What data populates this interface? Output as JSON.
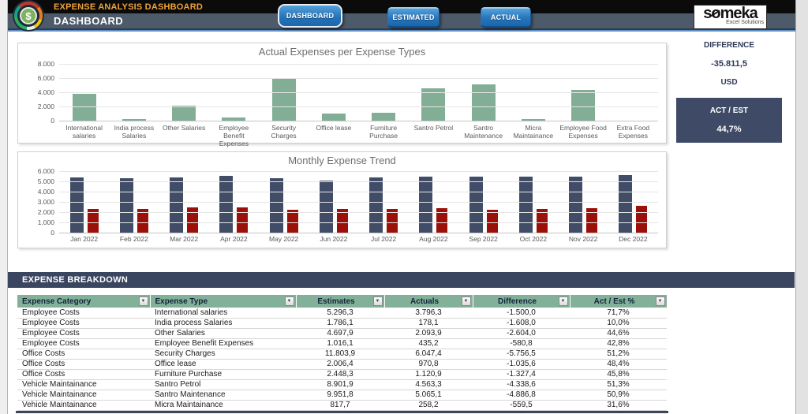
{
  "header": {
    "app_title": "EXPENSE ANALYSIS DASHBOARD",
    "page_title": "DASHBOARD",
    "nav_buttons": [
      {
        "label": "DASHBOARD",
        "active": true
      },
      {
        "label": "ESTIMATED",
        "active": false
      },
      {
        "label": "ACTUAL",
        "active": false
      }
    ],
    "logo_symbol": "$",
    "brand": {
      "name": "someka",
      "tagline": "Excel Solutions"
    }
  },
  "kpis": {
    "difference": {
      "label": "DIFFERENCE",
      "value": "-35.811,5",
      "unit": "USD"
    },
    "act_est": {
      "label": "ACT / EST",
      "value": "44,7%"
    }
  },
  "chart_data": [
    {
      "type": "bar",
      "title": "Actual Expenses per Expense Types",
      "categories": [
        "International salaries",
        "India process Salaries",
        "Other Salaries",
        "Employee Benefit Expenses",
        "Security Charges",
        "Office lease",
        "Furniture Purchase",
        "Santro Petrol",
        "Santro Maintenance",
        "Micra Maintainance",
        "Employee Food Expenses",
        "Extra Food Expenses"
      ],
      "values": [
        3796.3,
        178.1,
        2093.9,
        435.2,
        6047.4,
        970.8,
        1120.9,
        4563.3,
        5065.1,
        258.2,
        4300,
        40
      ],
      "ylim": [
        0,
        8000
      ],
      "yticks": [
        "8.000",
        "6.000",
        "4.000",
        "2.000",
        "0"
      ],
      "bar_color": "#83ae96",
      "grid": true,
      "legend": "none"
    },
    {
      "type": "bar",
      "title": "Monthly Expense Trend",
      "categories": [
        "Jan 2022",
        "Feb 2022",
        "Mar 2022",
        "Apr 2022",
        "May 2022",
        "Jun 2022",
        "Jul 2022",
        "Aug 2022",
        "Sep 2022",
        "Oct 2022",
        "Nov 2022",
        "Dec 2022"
      ],
      "series": [
        {
          "name": "Estimates",
          "color": "#414d66",
          "values": [
            5400,
            5300,
            5400,
            5550,
            5300,
            5050,
            5350,
            5500,
            5450,
            5450,
            5500,
            5600
          ]
        },
        {
          "name": "Actuals",
          "color": "#9b1109",
          "values": [
            2300,
            2300,
            2500,
            2500,
            2200,
            2300,
            2300,
            2350,
            2250,
            2300,
            2400,
            2600
          ]
        }
      ],
      "ylim": [
        0,
        6000
      ],
      "yticks": [
        "6.000",
        "5.000",
        "4.000",
        "3.000",
        "2.000",
        "1.000",
        "0"
      ],
      "grid": true,
      "legend": "none"
    }
  ],
  "breakdown": {
    "section_title": "EXPENSE BREAKDOWN",
    "columns": [
      "Expense Category",
      "Expense Type",
      "Estimates",
      "Actuals",
      "Difference",
      "Act / Est %"
    ],
    "rows": [
      [
        "Employee Costs",
        "International salaries",
        "5.296,3",
        "3.796,3",
        "-1.500,0",
        "71,7%"
      ],
      [
        "Employee Costs",
        "India process Salaries",
        "1.786,1",
        "178,1",
        "-1.608,0",
        "10,0%"
      ],
      [
        "Employee Costs",
        "Other Salaries",
        "4.697,9",
        "2.093,9",
        "-2.604,0",
        "44,6%"
      ],
      [
        "Employee Costs",
        "Employee Benefit Expenses",
        "1.016,1",
        "435,2",
        "-580,8",
        "42,8%"
      ],
      [
        "Office Costs",
        "Security Charges",
        "11.803,9",
        "6.047,4",
        "-5.756,5",
        "51,2%"
      ],
      [
        "Office Costs",
        "Office lease",
        "2.006,4",
        "970,8",
        "-1.035,6",
        "48,4%"
      ],
      [
        "Office Costs",
        "Furniture Purchase",
        "2.448,3",
        "1.120,9",
        "-1.327,4",
        "45,8%"
      ],
      [
        "Vehicle Maintainance",
        "Santro Petrol",
        "8.901,9",
        "4.563,3",
        "-4.338,6",
        "51,3%"
      ],
      [
        "Vehicle Maintainance",
        "Santro Maintenance",
        "9.951,8",
        "5.065,1",
        "-4.886,8",
        "50,9%"
      ],
      [
        "Vehicle Maintainance",
        "Micra Maintainance",
        "817,7",
        "258,2",
        "-559,5",
        "31,6%"
      ]
    ]
  },
  "colors": {
    "header_black": "#0b0b0b",
    "header_slate": "#4d5a6a",
    "accent_orange": "#eda33a",
    "navy_band": "#3a4660",
    "kpi_navy": "#3f4b66",
    "table_header_green": "#82b098",
    "bar_green": "#83ae96",
    "bar_navy": "#414d66",
    "bar_red": "#9b1109",
    "button_blue": "#2674ba"
  }
}
